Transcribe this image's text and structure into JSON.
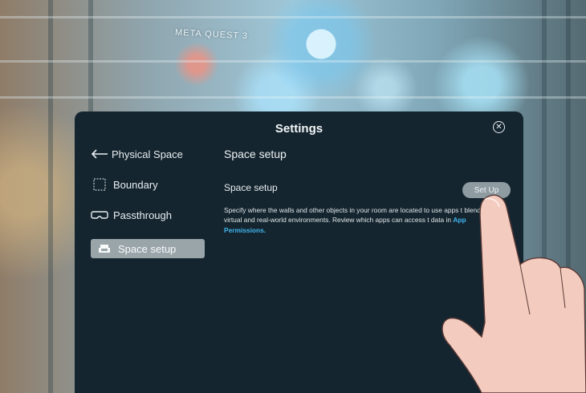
{
  "background": {
    "label": "META QUEST 3"
  },
  "panel": {
    "title": "Settings",
    "close_icon": "close-circle-icon"
  },
  "sidebar": {
    "items": [
      {
        "label": "Physical Space",
        "icon": "back-arrow-icon"
      },
      {
        "label": "Boundary",
        "icon": "boundary-icon"
      },
      {
        "label": "Passthrough",
        "icon": "headset-icon"
      },
      {
        "label": "Space setup",
        "icon": "couch-icon",
        "selected": true
      }
    ]
  },
  "content": {
    "section_title": "Space setup",
    "row_label": "Space setup",
    "setup_button": "Set Up",
    "description": "Specify where the walls and other objects in your room are located to use apps t blend your virtual and real-world environments. Review which apps can access t data in ",
    "description_link": "App Permissions."
  },
  "colors": {
    "panel_bg": "#15252f",
    "selected_bg": "#9aa5aa",
    "link": "#3fb6ef"
  }
}
